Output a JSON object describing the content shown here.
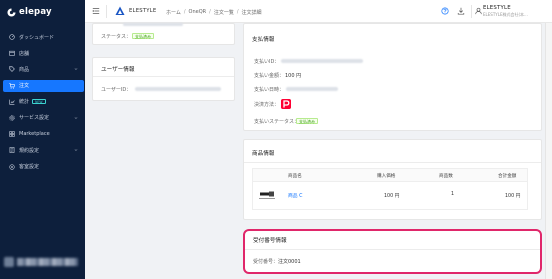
{
  "sidebar": {
    "logo_text": "elepay",
    "items": [
      {
        "label": "ダッシュボード",
        "icon": "dashboard-icon"
      },
      {
        "label": "店舗",
        "icon": "store-icon"
      },
      {
        "label": "商品",
        "icon": "tag-icon"
      },
      {
        "label": "注文",
        "icon": "cart-icon",
        "active": true
      },
      {
        "label": "統計",
        "icon": "stats-icon",
        "badge": "NEW"
      },
      {
        "label": "サービス設定",
        "icon": "service-settings-icon"
      },
      {
        "label": "Marketplace",
        "icon": "marketplace-icon"
      },
      {
        "label": "規約設定",
        "icon": "terms-icon"
      },
      {
        "label": "客室設定",
        "icon": "room-settings-icon"
      }
    ]
  },
  "topbar": {
    "tenant_name": "ELESTYLE",
    "breadcrumb": [
      "ホーム",
      "OneQR",
      "注文一覧",
      "注文詳細"
    ],
    "breadcrumb_separator": "/",
    "user_name": "ELESTYLE",
    "user_company": "ELESTYLE株式会社(本..."
  },
  "left_top_card": {
    "status_label": "ステータス：",
    "status_value": "支払済み"
  },
  "user_info": {
    "title": "ユーザー情報",
    "user_id_label": "ユーザーID："
  },
  "payment_info": {
    "title": "支払情報",
    "payment_id_label": "支払いID：",
    "amount_label": "支払い金額：",
    "amount_value": "100 円",
    "date_label": "支払い日時：",
    "method_label": "決済方法：",
    "status_label": "支払いステータス：",
    "status_value": "支払済み"
  },
  "product_info": {
    "title": "商品情報",
    "columns": [
      "商品名",
      "購入価格",
      "商品数",
      "合計金額"
    ],
    "rows": [
      {
        "name": "商品 C",
        "price": "100 円",
        "quantity": "1",
        "total": "100 円"
      }
    ]
  },
  "reception": {
    "title": "受付番号情報",
    "number_label": "受付番号：",
    "number_value": "注文0001"
  },
  "colors": {
    "sidebar_bg": "#0d1f3c",
    "accent": "#1677ff",
    "highlight": "#e0276a",
    "status_green": "#389e0d",
    "paypay_red": "#ff0033"
  }
}
